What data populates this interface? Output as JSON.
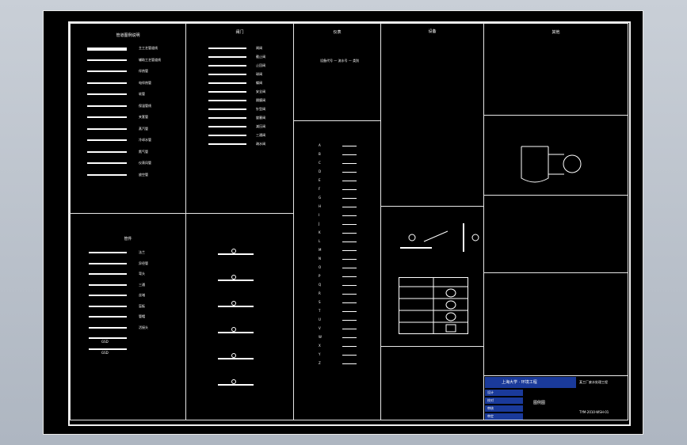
{
  "legend": {
    "pipes_title": "管道图例说明",
    "valves_title": "阀门",
    "fittings_title": "管件",
    "instruments_title": "仪表",
    "equipment_title": "设备",
    "misc_title": "其他",
    "items_left": [
      "主工艺管道线",
      "辅助工艺管道线",
      "伴热管",
      "电伴热管",
      "软管",
      "保温管线",
      "夹套管",
      "蒸汽管",
      "冷却水管",
      "氮气管",
      "仪表风管",
      "放空管"
    ],
    "items_valves": [
      "闸阀",
      "截止阀",
      "止回阀",
      "球阀",
      "蝶阀",
      "安全阀",
      "隔膜阀",
      "针型阀",
      "旋塞阀",
      "减压阀",
      "三通阀",
      "疏水阀"
    ],
    "code_table": [
      "A",
      "B",
      "C",
      "D",
      "E",
      "F",
      "G",
      "H",
      "I",
      "J",
      "K",
      "L",
      "M",
      "N",
      "O",
      "P",
      "Q",
      "R",
      "S",
      "T",
      "U",
      "V",
      "W",
      "X",
      "Y",
      "Z"
    ],
    "code_line": "设备代号 — 流水号 — 类别",
    "fittings_labels": [
      "法兰",
      "异径管",
      "弯头",
      "三通",
      "丝堵",
      "盲板",
      "管帽",
      "活接头",
      "GSD",
      "GSD"
    ]
  },
  "title_block": {
    "org": "上海大学 · 环境工程",
    "project": "某工厂废水处理工程",
    "drawing_name": "图例图",
    "drawing_no": "TYM-2010-WSH-01",
    "row_labels": [
      "设计",
      "校对",
      "审核",
      "审定"
    ]
  },
  "colors": {
    "sheet": "#000000",
    "line": "#ffffff",
    "title_fill": "#1a3a9a",
    "background": "#b8bfc9"
  }
}
